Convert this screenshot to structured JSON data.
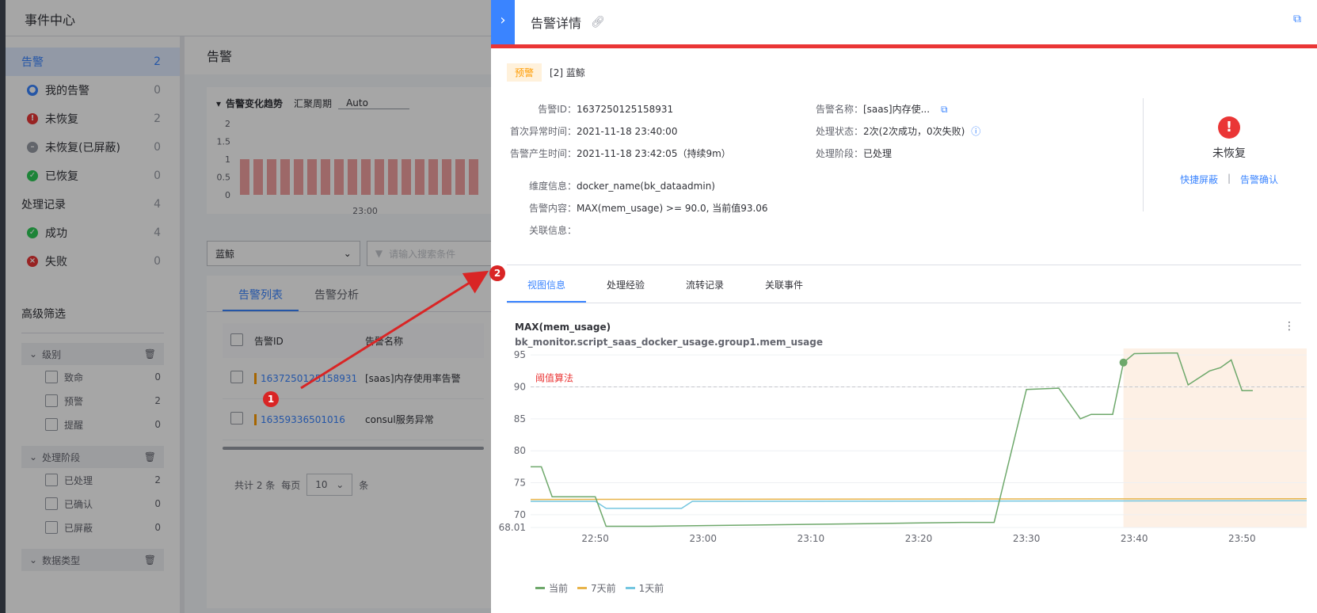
{
  "app": {
    "title": "事件中心"
  },
  "sidebar": {
    "items": [
      {
        "label": "告警",
        "count": "2"
      },
      {
        "label": "我的告警",
        "count": "0"
      },
      {
        "label": "未恢复",
        "count": "2"
      },
      {
        "label": "未恢复(已屏蔽)",
        "count": "0"
      },
      {
        "label": "已恢复",
        "count": "0"
      },
      {
        "label": "处理记录",
        "count": "4"
      },
      {
        "label": "成功",
        "count": "4"
      },
      {
        "label": "失败",
        "count": "0"
      }
    ],
    "advanced_title": "高级筛选",
    "groups": [
      {
        "title": "级别",
        "options": [
          {
            "label": "致命",
            "count": "0"
          },
          {
            "label": "预警",
            "count": "2"
          },
          {
            "label": "提醒",
            "count": "0"
          }
        ]
      },
      {
        "title": "处理阶段",
        "options": [
          {
            "label": "已处理",
            "count": "2"
          },
          {
            "label": "已确认",
            "count": "0"
          },
          {
            "label": "已屏蔽",
            "count": "0"
          }
        ]
      },
      {
        "title": "数据类型",
        "options": []
      }
    ]
  },
  "main": {
    "title": "告警",
    "trend": {
      "title": "告警变化趋势",
      "period_label": "汇聚周期",
      "period_value": "Auto",
      "y_ticks": [
        "2",
        "1.5",
        "1",
        "0.5",
        "0"
      ],
      "x_tick": "23:00"
    },
    "filter": {
      "space": "蓝鲸",
      "search_placeholder": "请输入搜索条件"
    },
    "tabs": [
      "告警列表",
      "告警分析"
    ],
    "table": {
      "headers": [
        "告警ID",
        "告警名称"
      ],
      "rows": [
        {
          "id": "1637250125158931",
          "name": "[saas]内存使用率告警"
        },
        {
          "id": "16359336501016",
          "name": "consul服务异常"
        }
      ]
    },
    "pager": {
      "total": "共计 2 条",
      "per_page_label": "每页",
      "per_page": "10",
      "unit": "条"
    }
  },
  "annotations": {
    "badge1": "1",
    "badge2": "2"
  },
  "detail": {
    "title": "告警详情",
    "level_tag": "预警",
    "space": "[2] 蓝鲸",
    "fields": {
      "alert_id_label": "告警ID：",
      "alert_id": "1637250125158931",
      "first_time_label": "首次异常时间：",
      "first_time": "2021-11-18 23:40:00",
      "create_time_label": "告警产生时间：",
      "create_time": "2021-11-18 23:42:05（持续9m）",
      "dim_label": "维度信息：",
      "dim": "docker_name(bk_dataadmin)",
      "content_label": "告警内容：",
      "content": "MAX(mem_usage) >= 90.0, 当前值93.06",
      "relate_label": "关联信息：",
      "name_label": "告警名称：",
      "name": "[saas]内存使...",
      "handle_label": "处理状态：",
      "handle": "2次(2次成功，0次失败)",
      "stage_label": "处理阶段：",
      "stage": "已处理"
    },
    "status": {
      "text": "未恢复",
      "shield": "快捷屏蔽",
      "sep": "|",
      "confirm": "告警确认"
    },
    "tabs": [
      "视图信息",
      "处理经验",
      "流转记录",
      "关联事件"
    ],
    "metric_title": "MAX(mem_usage)",
    "metric_subtitle": "bk_monitor.script_saas_docker_usage.group1.mem_usage",
    "threshold_label": "阈值算法",
    "colors": {
      "current": "#6ea86b",
      "seven_days": "#e8b44b",
      "one_day": "#74c6e0",
      "threshold": "#ea3636",
      "accent": "#3a84ff"
    }
  },
  "chart_data": {
    "type": "line",
    "title": "MAX(mem_usage)",
    "ylim": [
      68.01,
      96
    ],
    "y_ticks": [
      "95",
      "90",
      "85",
      "80",
      "75",
      "70",
      "68.01"
    ],
    "x_ticks": [
      "22:50",
      "23:00",
      "23:10",
      "23:20",
      "23:30",
      "23:40",
      "23:50"
    ],
    "threshold": 90,
    "highlight_range": [
      "23:39",
      "23:56"
    ],
    "series": [
      {
        "name": "当前",
        "points": [
          [
            "22:44",
            77.5
          ],
          [
            "22:45",
            77.5
          ],
          [
            "22:46",
            72.8
          ],
          [
            "22:48",
            72.8
          ],
          [
            "22:50",
            72.8
          ],
          [
            "22:51",
            68.2
          ],
          [
            "22:55",
            68.2
          ],
          [
            "23:05",
            68.4
          ],
          [
            "23:15",
            68.6
          ],
          [
            "23:24",
            68.8
          ],
          [
            "23:27",
            68.8
          ],
          [
            "23:30",
            89.6
          ],
          [
            "23:33",
            89.8
          ],
          [
            "23:35",
            85
          ],
          [
            "23:36",
            85.7
          ],
          [
            "23:38",
            85.7
          ],
          [
            "23:39",
            93.8
          ],
          [
            "23:40",
            95.2
          ],
          [
            "23:43",
            95.3
          ],
          [
            "23:44",
            95.3
          ],
          [
            "23:45",
            90.3
          ],
          [
            "23:47",
            92.5
          ],
          [
            "23:48",
            93
          ],
          [
            "23:49",
            94.2
          ],
          [
            "23:50",
            89.4
          ],
          [
            "23:51",
            89.4
          ]
        ]
      },
      {
        "name": "7天前",
        "points": [
          [
            "22:44",
            72.4
          ],
          [
            "23:56",
            72.5
          ]
        ]
      },
      {
        "name": "1天前",
        "points": [
          [
            "22:44",
            72.1
          ],
          [
            "22:50",
            72.1
          ],
          [
            "22:51",
            71
          ],
          [
            "22:58",
            71
          ],
          [
            "22:59",
            72.1
          ],
          [
            "23:56",
            72.2
          ]
        ]
      }
    ]
  }
}
